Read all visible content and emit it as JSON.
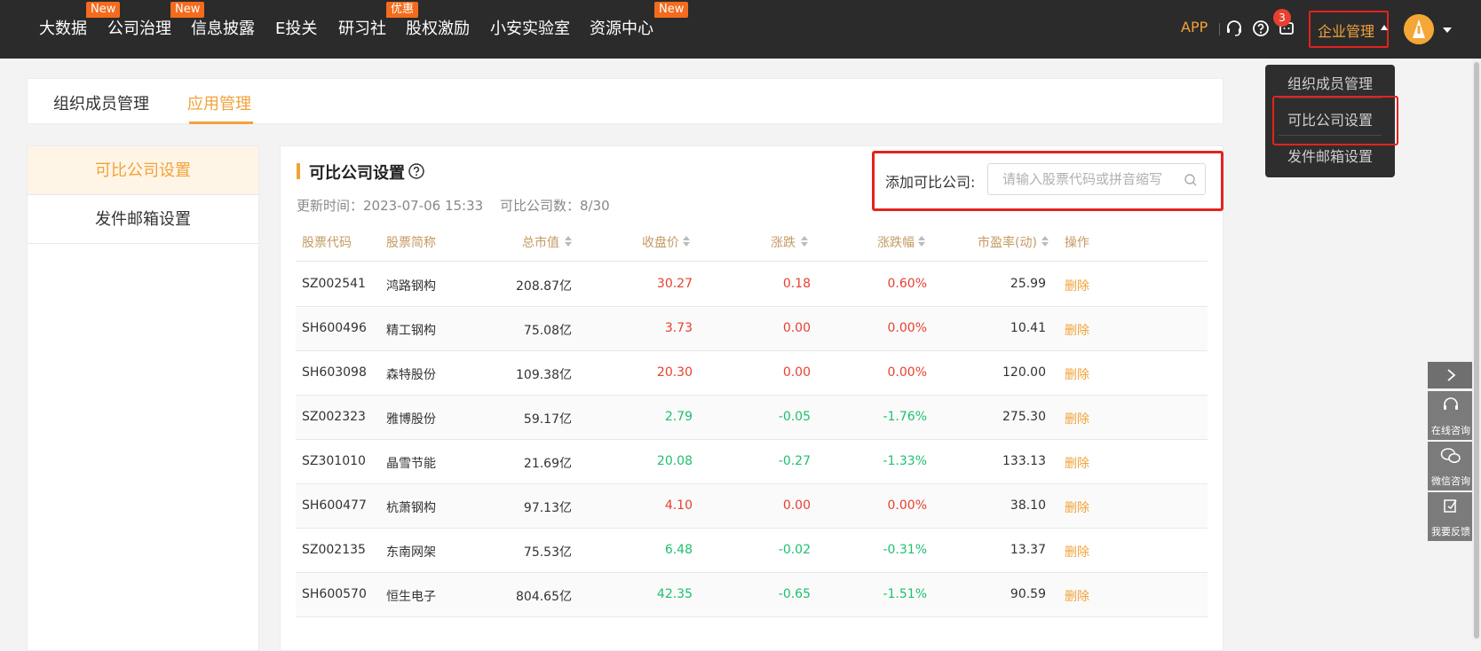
{
  "nav": {
    "items": [
      {
        "label": "大数据",
        "badge": "New"
      },
      {
        "label": "公司治理",
        "badge": "New"
      },
      {
        "label": "信息披露",
        "badge": ""
      },
      {
        "label": "E投关",
        "badge": ""
      },
      {
        "label": "研习社",
        "badge": "优惠"
      },
      {
        "label": "股权激励",
        "badge": ""
      },
      {
        "label": "小安实验室",
        "badge": ""
      },
      {
        "label": "资源中心",
        "badge": "New"
      }
    ],
    "app_label": "APP",
    "message_count": "3",
    "enterprise_label": "企业管理"
  },
  "dropdown": {
    "items": [
      "组织成员管理",
      "可比公司设置",
      "发件邮箱设置"
    ]
  },
  "tabs": [
    "组织成员管理",
    "应用管理"
  ],
  "side_menu": [
    "可比公司设置",
    "发件邮箱设置"
  ],
  "panel": {
    "title": "可比公司设置",
    "update_time": "更新时间：2023-07-06 15:33",
    "company_count": "可比公司数：8/30",
    "add_label": "添加可比公司:",
    "search_placeholder": "请输入股票代码或拼音缩写"
  },
  "table": {
    "headers": [
      "股票代码",
      "股票简称",
      "总市值",
      "收盘价",
      "涨跌",
      "涨跌幅",
      "市盈率(动)",
      "操作"
    ],
    "rows": [
      {
        "code": "SZ002541",
        "name": "鸿路钢构",
        "cap": "208.87亿",
        "close": "30.27",
        "chg": "0.18",
        "pct": "0.60%",
        "pe": "25.99",
        "op": "删除",
        "trend": "up"
      },
      {
        "code": "SH600496",
        "name": "精工钢构",
        "cap": "75.08亿",
        "close": "3.73",
        "chg": "0.00",
        "pct": "0.00%",
        "pe": "10.41",
        "op": "删除",
        "trend": "up"
      },
      {
        "code": "SH603098",
        "name": "森特股份",
        "cap": "109.38亿",
        "close": "20.30",
        "chg": "0.00",
        "pct": "0.00%",
        "pe": "120.00",
        "op": "删除",
        "trend": "up"
      },
      {
        "code": "SZ002323",
        "name": "雅博股份",
        "cap": "59.17亿",
        "close": "2.79",
        "chg": "-0.05",
        "pct": "-1.76%",
        "pe": "275.30",
        "op": "删除",
        "trend": "down"
      },
      {
        "code": "SZ301010",
        "name": "晶雪节能",
        "cap": "21.69亿",
        "close": "20.08",
        "chg": "-0.27",
        "pct": "-1.33%",
        "pe": "133.13",
        "op": "删除",
        "trend": "down"
      },
      {
        "code": "SH600477",
        "name": "杭萧钢构",
        "cap": "97.13亿",
        "close": "4.10",
        "chg": "0.00",
        "pct": "0.00%",
        "pe": "38.10",
        "op": "删除",
        "trend": "up"
      },
      {
        "code": "SZ002135",
        "name": "东南网架",
        "cap": "75.53亿",
        "close": "6.48",
        "chg": "-0.02",
        "pct": "-0.31%",
        "pe": "13.37",
        "op": "删除",
        "trend": "down"
      },
      {
        "code": "SH600570",
        "name": "恒生电子",
        "cap": "804.65亿",
        "close": "42.35",
        "chg": "-0.65",
        "pct": "-1.51%",
        "pe": "90.59",
        "op": "删除",
        "trend": "down"
      }
    ]
  },
  "float_tools": [
    "在线咨询",
    "微信咨询",
    "我要反馈"
  ],
  "colors": {
    "accent": "#f2a23a",
    "up": "#e8402f",
    "down": "#1fbf6f",
    "highlight": "#e3231e"
  }
}
